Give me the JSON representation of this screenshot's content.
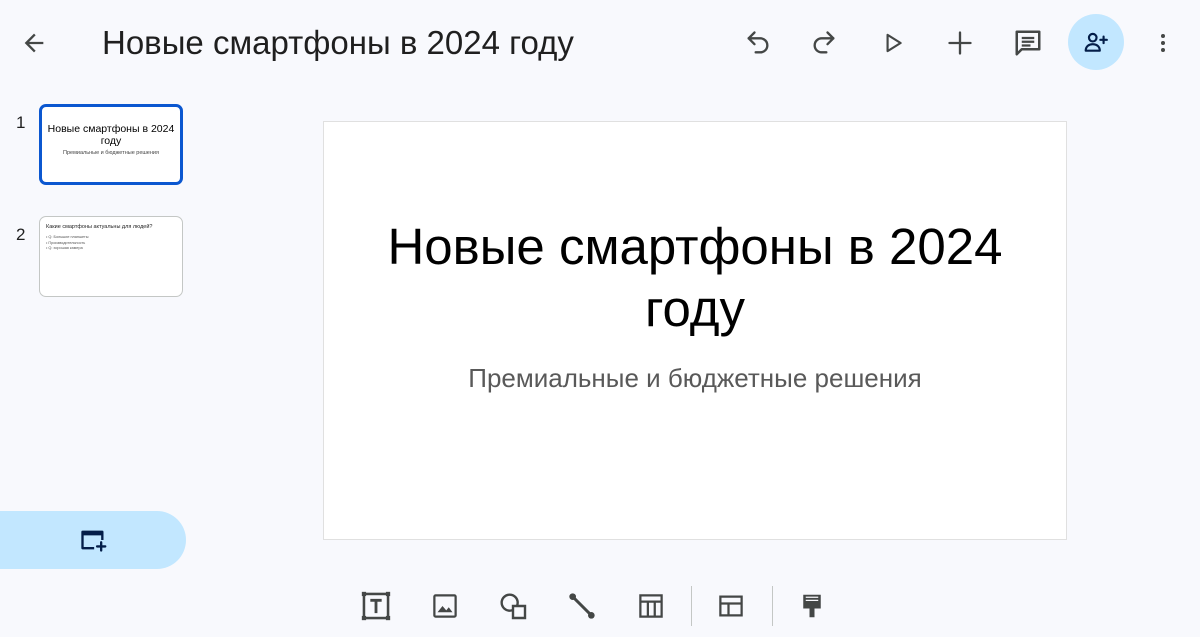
{
  "header": {
    "title": "Новые смартфоны в 2024 году",
    "icons": {
      "back": "arrow-back-icon",
      "undo": "undo-icon",
      "redo": "redo-icon",
      "present": "play-icon",
      "insert": "plus-icon",
      "comments": "comment-icon",
      "share": "person-add-icon",
      "more": "more-vert-icon"
    },
    "share_bg_color": "#c2e7ff"
  },
  "slides_panel": {
    "slides": [
      {
        "number": "1",
        "title": "Новые смартфоны в 2024 году",
        "subtitle": "Премиальные и бюджетные решения",
        "selected": true
      },
      {
        "number": "2",
        "title": "Какие смартфоны актуальны для людей?",
        "bullets": [
          "Q: Большие планшеты",
          "Производительность",
          "Q: хорошая камера"
        ],
        "selected": false
      }
    ],
    "selected_border_color": "#0b57d0",
    "new_slide_icon": "new-slide-icon"
  },
  "canvas": {
    "title": "Новые смартфоны в 2024 году",
    "subtitle": "Премиальные и бюджетные решения"
  },
  "toolbar": {
    "tools": [
      "text-box-icon",
      "image-icon",
      "shapes-icon",
      "line-icon",
      "table-icon",
      "layout-icon",
      "format-paint-icon"
    ]
  }
}
